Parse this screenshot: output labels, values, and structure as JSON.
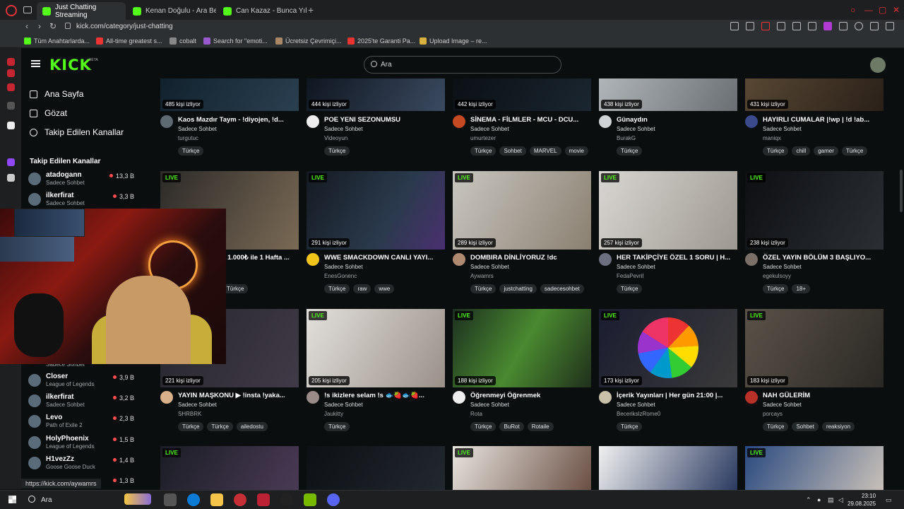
{
  "browser": {
    "tabs": [
      {
        "label": "Just Chatting Streaming"
      },
      {
        "label": "Kenan Doğulu - Ara Beni"
      },
      {
        "label": "Can Kazaz - Bunca Yıl - A"
      }
    ],
    "url": "kick.com/category/just-chatting",
    "bookmarks": [
      "Tüm Anahtarlarda...",
      "All-time greatest s...",
      "cobalt",
      "Search for \"emoti...",
      "Ücretsiz Çevrimiçi...",
      "2025'te Garanti Pa...",
      "Upload Image – re..."
    ]
  },
  "header": {
    "logo": "KICK",
    "beta": "BETA",
    "search_placeholder": "Ara"
  },
  "sidebar": {
    "nav": [
      {
        "label": "Ana Sayfa",
        "icon": "home-icon"
      },
      {
        "label": "Gözat",
        "icon": "browse-icon"
      },
      {
        "label": "Takip Edilen Kanallar",
        "icon": "heart-icon"
      }
    ],
    "followed_title": "Takip Edilen Kanallar",
    "channels_top": [
      {
        "name": "atadogann",
        "category": "Sadece Sohbet",
        "viewers": "13,3 B"
      },
      {
        "name": "ilkerfirat",
        "category": "Sadece Sohbet",
        "viewers": "3,3 B"
      }
    ],
    "partial_category": "Sadece Sohbet",
    "channels_bottom": [
      {
        "name": "Closer",
        "category": "League of Legends",
        "viewers": "3,9 B"
      },
      {
        "name": "ilkerfirat",
        "category": "Sadece Sohbet",
        "viewers": "3,2 B"
      },
      {
        "name": "Levo",
        "category": "Path of Exile 2",
        "viewers": "2,3 B"
      },
      {
        "name": "HolyPhoenix",
        "category": "League of Legends",
        "viewers": "1,5 B"
      },
      {
        "name": "H1vezZz",
        "category": "Goose Goose Duck",
        "viewers": "1,4 B"
      },
      {
        "name": "",
        "category": "",
        "viewers": "1,3 B"
      }
    ]
  },
  "live_badge": "LIVE",
  "streams": [
    {
      "viewers": "485 kişi izliyor",
      "title": "Kaos Mazdır Taym - !diyojen, !d...",
      "category": "Sadece Sohbet",
      "user": "turgutuc",
      "tags": [
        "Türkçe"
      ]
    },
    {
      "viewers": "444 kişi izliyor",
      "title": "POE YENI SEZONUMSU",
      "category": "Sadece Sohbet",
      "user": "Videoyun",
      "tags": [
        "Türkçe"
      ]
    },
    {
      "viewers": "442 kişi izliyor",
      "title": "SİNEMA - FİLMLER - MCU - DCU...",
      "category": "Sadece Sohbet",
      "user": "umurtezer",
      "tags": [
        "Türkçe",
        "Sohbet",
        "MARVEL",
        "movie"
      ]
    },
    {
      "viewers": "438 kişi izliyor",
      "title": "Günaydın",
      "category": "Sadece Sohbet",
      "user": "BurakG",
      "tags": [
        "Türkçe"
      ]
    },
    {
      "viewers": "431 kişi izliyor",
      "title": "HAYIRLI CUMALAR |!wp | !d !ab...",
      "category": "Sadece Sohbet",
      "user": "maniqx",
      "tags": [
        "Türkçe",
        "chill",
        "gamer",
        "Türkçe"
      ]
    },
    {
      "viewers": "",
      "title": "1.000₺ ile 1 Hafta ...",
      "category": "",
      "user": "",
      "tags": [
        "Türkçe"
      ]
    },
    {
      "viewers": "291 kişi izliyor",
      "title": "WWE SMACKDOWN CANLI YAYI...",
      "category": "Sadece Sohbet",
      "user": "EnesGonenc",
      "tags": [
        "Türkçe",
        "raw",
        "wwe"
      ]
    },
    {
      "viewers": "289 kişi izliyor",
      "title": "DOMBIRA DİNLİYORUZ !dc",
      "category": "Sadece Sohbet",
      "user": "Aywamrs",
      "tags": [
        "Türkçe",
        "justchatting",
        "sadecesohbet"
      ]
    },
    {
      "viewers": "257 kişi izliyor",
      "title": "HER TAKİPÇİYE ÖZEL 1 SORU | H...",
      "category": "Sadece Sohbet",
      "user": "FedaPevril",
      "tags": [
        "Türkçe"
      ]
    },
    {
      "viewers": "238 kişi izliyor",
      "title": "ÖZEL YAYIN BÖLÜM 3 BAŞLIYO...",
      "category": "Sadece Sohbet",
      "user": "egekulsoyy",
      "tags": [
        "Türkçe",
        "18+"
      ]
    },
    {
      "viewers": "221 kişi izliyor",
      "title": "YAYIN MAŞKONU ▶ !insta !yaka...",
      "category": "Sadece Sohbet",
      "user": "SHRBRK",
      "tags": [
        "Türkçe",
        "Türkçe",
        "ailedostu"
      ]
    },
    {
      "viewers": "205 kişi izliyor",
      "title": "!s ikizlere selam !s 🐟🍓🐟🍓...",
      "category": "Sadece Sohbet",
      "user": "Jaukitty",
      "tags": [
        "Türkçe"
      ]
    },
    {
      "viewers": "188 kişi izliyor",
      "title": "Öğrenmeyi Öğrenmek",
      "category": "Sadece Sohbet",
      "user": "Rota",
      "tags": [
        "Türkçe",
        "BuRot",
        "Rotaile"
      ]
    },
    {
      "viewers": "173 kişi izliyor",
      "title": "İçerik Yayınları | Her gün 21:00 |...",
      "category": "Sadece Sohbet",
      "user": "BecerikslzRome0",
      "tags": [
        "Türkçe"
      ]
    },
    {
      "viewers": "183 kişi izliyor",
      "title": "NAH GÜLERİM",
      "category": "Sadece Sohbet",
      "user": "porcays",
      "tags": [
        "Türkçe",
        "Sohbet",
        "reaksiyon"
      ]
    }
  ],
  "status_url": "https://kick.com/aywamrs",
  "taskbar": {
    "search": "Ara",
    "time": "23:10",
    "date": "29.08.2025"
  }
}
